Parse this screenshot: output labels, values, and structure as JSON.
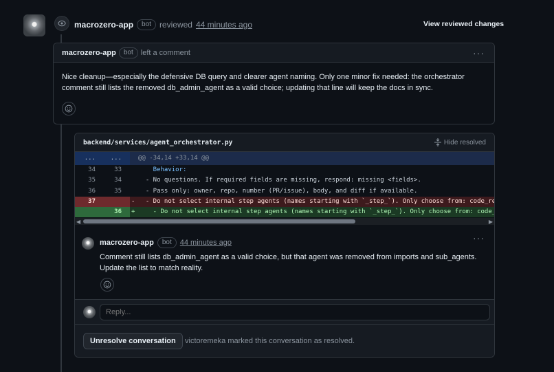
{
  "review": {
    "author": "macrozero-app",
    "badge": "bot",
    "action": "reviewed",
    "time": "44 minutes ago",
    "view_changes": "View reviewed changes"
  },
  "summary": {
    "author": "macrozero-app",
    "badge": "bot",
    "action": "left a comment",
    "menu": "···",
    "body": "Nice cleanup—especially the defensive DB query and clearer agent naming. Only one minor fix needed: the orchestrator comment still lists the removed db_admin_agent as a valid choice; updating that line will keep the docs in sync."
  },
  "file": {
    "path": "backend/services/agent_orchestrator.py",
    "hide_resolved": "Hide resolved",
    "hunk": {
      "left": "...",
      "right": "...",
      "text": "@@ -34,14 +33,14 @@"
    },
    "lines": [
      {
        "type": "ctx",
        "old": "34",
        "new": "33",
        "sign": "",
        "code": "    Behavior:"
      },
      {
        "type": "ctx",
        "old": "35",
        "new": "34",
        "sign": "",
        "code": "  - No questions. If required fields are missing, respond: missing <fields>."
      },
      {
        "type": "ctx",
        "old": "36",
        "new": "35",
        "sign": "",
        "code": "  - Pass only: owner, repo, number (PR/issue), body, and diff if available."
      },
      {
        "type": "del",
        "old": "37",
        "new": "",
        "sign": "-",
        "code": "  - Do not select internal step agents (names starting with `_step_`). Only choose from: code_review_ag"
      },
      {
        "type": "add",
        "old": "",
        "new": "36",
        "sign": "+",
        "code": "    - Do not select internal step agents (names starting with `_step_`). Only choose from: code_review_"
      }
    ]
  },
  "comment": {
    "author": "macrozero-app",
    "badge": "bot",
    "time": "44 minutes ago",
    "menu": "···",
    "body": "Comment still lists db_admin_agent as a valid choice, but that agent was removed from imports and sub_agents. Update the list to match reality."
  },
  "reply": {
    "placeholder": "Reply..."
  },
  "resolve": {
    "button": "Unresolve conversation",
    "status": "victoremeka marked this conversation as resolved."
  },
  "colors": {
    "background": "#0d1117",
    "border": "#30363d",
    "deleted": "#3d1a1d",
    "added": "#1b3a24",
    "hunk": "#1c2b4a"
  }
}
